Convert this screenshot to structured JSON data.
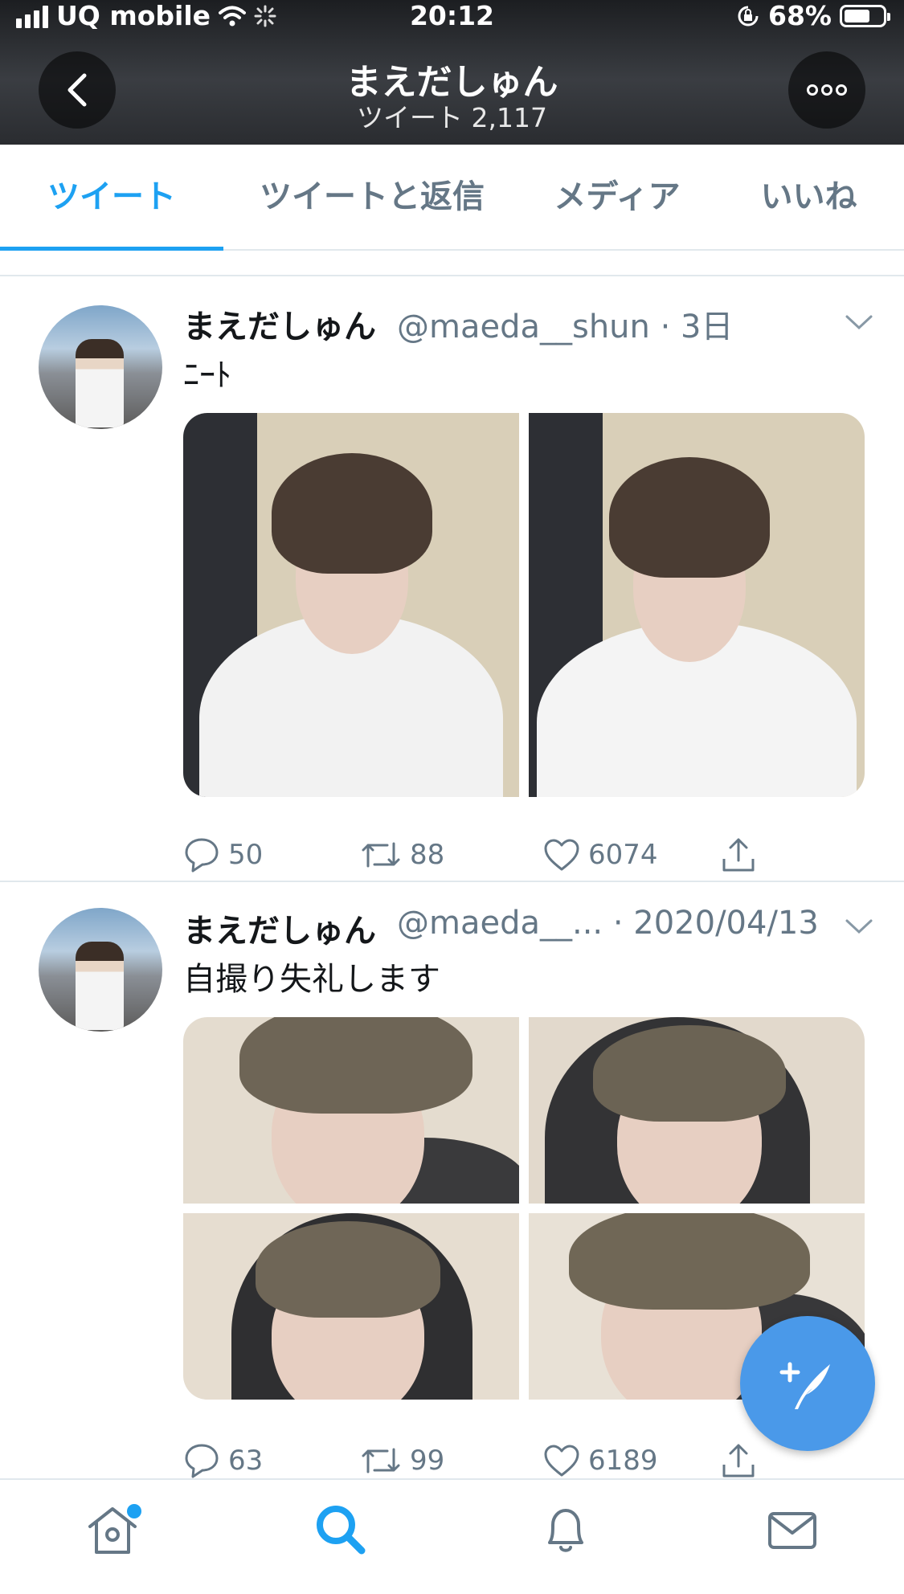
{
  "status_bar": {
    "carrier": "UQ mobile",
    "time": "20:12",
    "battery": "68%",
    "battery_level": 0.68
  },
  "header": {
    "title": "まえだしゅん",
    "subtitle": "ツイート 2,117"
  },
  "tabs": [
    {
      "label": "ツイート",
      "active": true
    },
    {
      "label": "ツイートと返信",
      "active": false
    },
    {
      "label": "メディア",
      "active": false
    },
    {
      "label": "いいね",
      "active": false
    }
  ],
  "tweets": [
    {
      "name": "まえだしゅん",
      "handle_time": "@maeda__shun · 3日",
      "text": "ﾆｰﾄ",
      "replies": "50",
      "retweets": "88",
      "likes": "6074",
      "photos": 2
    },
    {
      "name": "まえだしゅん",
      "handle_time": "@maeda__... · 2020/04/13",
      "text": "自撮り失礼します",
      "replies": "63",
      "retweets": "99",
      "likes": "6189",
      "photos": 4
    }
  ],
  "colors": {
    "accent": "#1da1f2",
    "fab": "#4a99e9",
    "secondary_text": "#657786"
  },
  "icons": {
    "back": "chevron-left-icon",
    "more": "more-dots-icon",
    "caret": "chevron-down-icon",
    "reply": "reply-bubble-icon",
    "retweet": "retweet-icon",
    "like": "heart-icon",
    "share": "share-icon",
    "compose": "compose-tweet-icon",
    "home": "home-icon",
    "search": "search-icon",
    "notifications": "bell-icon",
    "messages": "envelope-icon"
  }
}
